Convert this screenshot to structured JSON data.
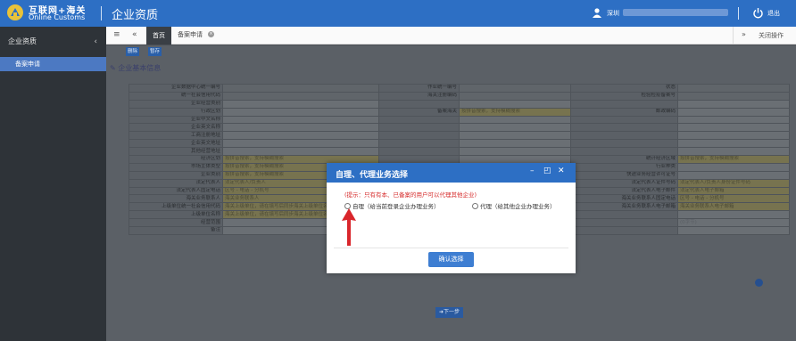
{
  "header": {
    "logo_cn": "互联网+海关",
    "logo_en": "Online Customs",
    "app_title": "企业资质",
    "user_name": "深圳",
    "logout": "退出"
  },
  "sidebar": {
    "section": "企业资质",
    "items": [
      {
        "label": "备案申请"
      }
    ]
  },
  "tabs": {
    "home": "首页",
    "filing": "备案申请",
    "close_ops": "关闭操作"
  },
  "toolbar": {
    "delete": "删除",
    "save": "暂存"
  },
  "section_title": "企业基本信息",
  "form_rows": [
    [
      "企业数据中心统一编号",
      "",
      "作业统一编号",
      "",
      "状态",
      ""
    ],
    [
      "统一社会信用代码",
      "",
      "海关注册编码",
      "",
      "检验检疫备案号",
      ""
    ],
    [
      "企业经营类别",
      "",
      "",
      "",
      "",
      ""
    ],
    [
      "行政区划",
      "",
      "备案海关",
      "按拼音搜索，支持模糊搜索",
      "邮政编码",
      ""
    ],
    [
      "企业中文名称",
      "",
      "",
      "",
      "",
      ""
    ],
    [
      "企业英文名称",
      "",
      "",
      "",
      "",
      ""
    ],
    [
      "工商注册地址",
      "",
      "",
      "",
      "",
      ""
    ],
    [
      "企业英文地址",
      "",
      "",
      "",
      "",
      ""
    ],
    [
      "其他经营地址",
      "",
      "",
      "",
      "",
      ""
    ],
    [
      "经济区划",
      "按拼音搜索，支持模糊搜索",
      "",
      "",
      "统计经济区域",
      "按拼音搜索，支持模糊搜索"
    ],
    [
      "市场主体类型",
      "按拼音搜索，支持模糊搜索",
      "",
      "",
      "行业种类",
      ""
    ],
    [
      "企业类别",
      "按拼音搜索，支持模糊搜索",
      "",
      "",
      "快递业务经营许可证号",
      ""
    ],
    [
      "法定代表人",
      "法定代表人/负责人",
      "",
      "",
      "法定代表人证件号码",
      "法定代表人/负责人身份证件号码"
    ],
    [
      "法定代表人固定电话",
      "区号  -  电话  -  分机号",
      "",
      "",
      "法定代表人电子邮件",
      "法定代表人电子邮箱"
    ],
    [
      "海关业务联系人",
      "海关业务联系人",
      "",
      "",
      "海关业务联系人固定电话",
      "区号  -  电话  -  分机号"
    ],
    [
      "上级单位统一社会信用代码",
      "海关上级单位，请在填写后同步海关上级单位名称",
      "",
      "",
      "海关业务联系人电子邮箱",
      "海关业务联系人电子邮箱"
    ],
    [
      "上级单位名称",
      "海关上级单位，请在填写后同步海关上级单位名称",
      "",
      "",
      "",
      ""
    ],
    [
      "经营范围",
      "",
      "",
      "",
      "",
      "(0字节)"
    ],
    [
      "备注",
      "",
      "",
      "",
      "",
      ""
    ]
  ],
  "next_button": "下一步",
  "modal": {
    "title": "自理、代理业务选择",
    "tip": "(提示：只有有本、已备案的用户可以代理其他企业)",
    "option_self": "自理（给当前登录企业办理业务）",
    "option_agent": "代理（给其他企业办理业务）",
    "confirm": "确认选择"
  },
  "colors": {
    "brand_blue": "#2d6fc4",
    "tip_red": "#d62c2c",
    "arrow_red": "#d9262b"
  }
}
